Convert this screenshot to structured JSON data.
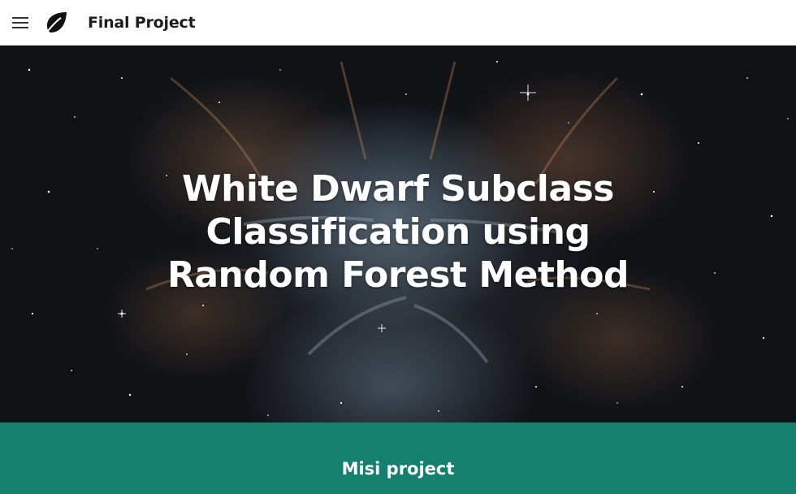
{
  "app_bar": {
    "title": "Final Project",
    "menu_icon": "hamburger-menu-icon",
    "logo_icon": "leaf-icon"
  },
  "hero": {
    "title": "White Dwarf Subclass Classification using Random Forest Method",
    "background": "nebula-image"
  },
  "section": {
    "title": "Misi project",
    "color": "#168070"
  }
}
